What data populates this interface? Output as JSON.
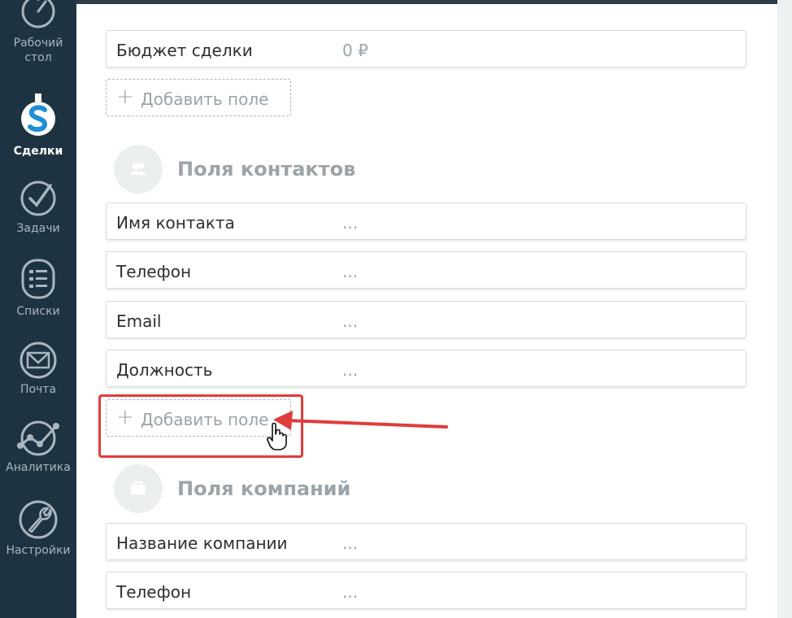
{
  "sidebar": {
    "items": [
      {
        "label_lines": [
          "Рабочий",
          "стол"
        ],
        "icon": "dashboard-gauge-icon"
      },
      {
        "label": "Сделки",
        "icon": "dollar-icon",
        "active": true
      },
      {
        "label": "Задачи",
        "icon": "checkmark-circle-icon"
      },
      {
        "label": "Списки",
        "icon": "list-document-icon"
      },
      {
        "label": "Почта",
        "icon": "mail-envelope-icon"
      },
      {
        "label": "Аналитика",
        "icon": "analytics-chart-icon"
      },
      {
        "label": "Настройки",
        "icon": "wrench-settings-icon"
      }
    ]
  },
  "deal_fields": [
    {
      "name": "Бюджет сделки",
      "value": "0 ₽"
    }
  ],
  "add_field_label": "Добавить поле",
  "add_plus": "+",
  "contacts_section": {
    "title": "Поля контактов",
    "icon": "contacts-people-icon",
    "fields": [
      {
        "name": "Имя контакта",
        "value": "..."
      },
      {
        "name": "Телефон",
        "value": "..."
      },
      {
        "name": "Email",
        "value": "..."
      },
      {
        "name": "Должность",
        "value": "..."
      }
    ]
  },
  "companies_section": {
    "title": "Поля компаний",
    "icon": "briefcase-icon",
    "fields": [
      {
        "name": "Название компании",
        "value": "..."
      },
      {
        "name": "Телефон",
        "value": "..."
      }
    ]
  },
  "colors": {
    "sidebar_bg": "#1e3342",
    "highlight": "#e23b3b",
    "active_icon": "#1e8fd6"
  }
}
